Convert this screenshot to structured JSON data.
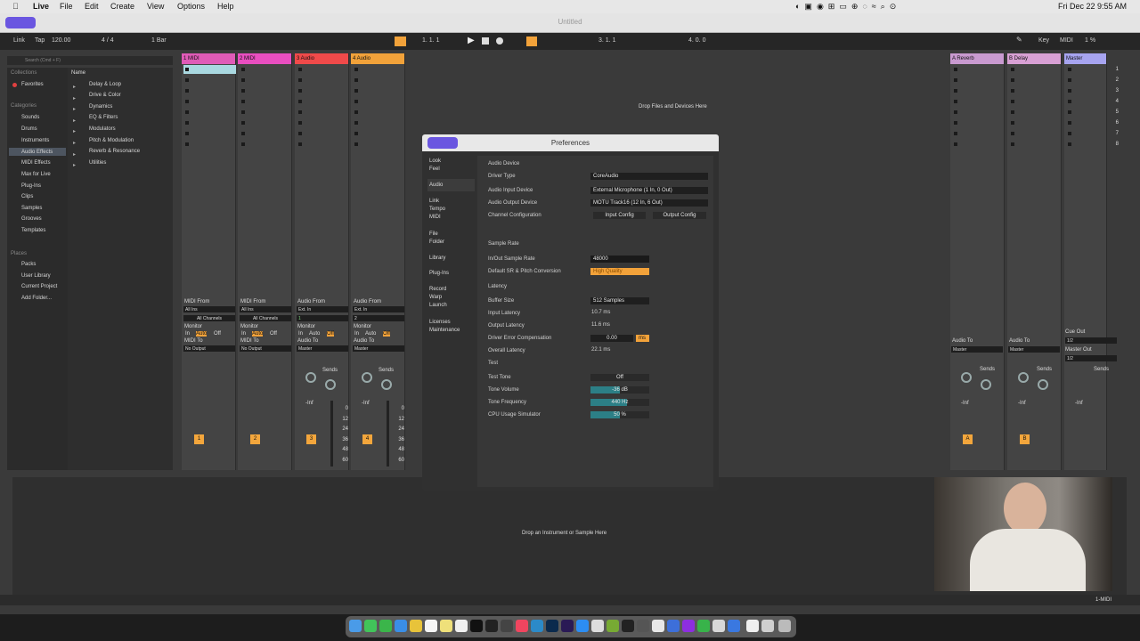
{
  "menubar": {
    "app": "Live",
    "items": [
      "File",
      "Edit",
      "Create",
      "View",
      "Options",
      "Help"
    ],
    "datetime": "Fri Dec 22  9:55 AM"
  },
  "window": {
    "title": "Untitled"
  },
  "control_bar": {
    "link": "Link",
    "tap": "Tap",
    "tempo": "120.00",
    "signature": "4 / 4",
    "quantize": "1 Bar",
    "position": "1.  1.  1",
    "loop_start": "3.  1.  1",
    "loop_length": "4.  0.  0",
    "key": "Key",
    "midi": "MIDI",
    "cpu": "1 %"
  },
  "browser": {
    "search_placeholder": "Search (Cmd + F)",
    "collections_header": "Collections",
    "collections": [
      "Favorites"
    ],
    "categories_header": "Categories",
    "categories": [
      "Sounds",
      "Drums",
      "Instruments",
      "Audio Effects",
      "MIDI Effects",
      "Max for Live",
      "Plug-Ins",
      "Clips",
      "Samples",
      "Grooves",
      "Templates"
    ],
    "places_header": "Places",
    "places": [
      "Packs",
      "User Library",
      "Current Project",
      "Add Folder..."
    ],
    "name_header": "Name",
    "folders": [
      "Delay & Loop",
      "Drive & Color",
      "Dynamics",
      "EQ & Filters",
      "Modulators",
      "Pitch & Modulation",
      "Reverb & Resonance",
      "Utilities"
    ]
  },
  "tracks": [
    {
      "name": "1 MIDI",
      "color": "#e05bb7",
      "io_label": "MIDI From",
      "io": "All Ins",
      "ch": "All Channels",
      "out_label": "MIDI To",
      "out": "No Output",
      "num": "1"
    },
    {
      "name": "2 MIDI",
      "color": "#e94ec0",
      "io_label": "MIDI From",
      "io": "All Ins",
      "ch": "All Channels",
      "out_label": "MIDI To",
      "out": "No Output",
      "num": "2"
    },
    {
      "name": "3 Audio",
      "color": "#f04a4a",
      "io_label": "Audio From",
      "io": "Ext. In",
      "ch": "1",
      "out_label": "Audio To",
      "out": "Master",
      "num": "3"
    },
    {
      "name": "4 Audio",
      "color": "#f2a23a",
      "io_label": "Audio From",
      "io": "Ext. In",
      "ch": "2",
      "out_label": "Audio To",
      "out": "Master",
      "num": "4"
    }
  ],
  "returns": [
    {
      "name": "A Reverb",
      "color": "#c99ad0",
      "out_label": "Audio To",
      "out": "Master",
      "num": "A"
    },
    {
      "name": "B Delay",
      "color": "#d8a0d4",
      "out_label": "Audio To",
      "out": "Master",
      "num": "B"
    },
    {
      "name": "Master",
      "color": "#a7a4f0",
      "out_label": "Master Out",
      "out": "1/2",
      "num": ""
    }
  ],
  "mixer_labels": {
    "monitor": "Monitor",
    "in": "In",
    "auto": "Auto",
    "off": "Off",
    "sends": "Sends",
    "inf": "-Inf",
    "db_scale": [
      "0",
      "12",
      "24",
      "36",
      "48",
      "60"
    ],
    "cue_out": "Cue Out",
    "cue_val": "1/2"
  },
  "session": {
    "drop_files": "Drop Files and Devices Here",
    "scene_numbers": [
      "1",
      "2",
      "3",
      "4",
      "5",
      "6",
      "7",
      "8"
    ]
  },
  "detail": {
    "drop_instrument": "Drop an Instrument or Sample Here",
    "status": "1-MIDI"
  },
  "preferences": {
    "title": "Preferences",
    "nav": [
      [
        "Look",
        "Feel"
      ],
      [
        "Audio"
      ],
      [
        "Link",
        "Tempo",
        "MIDI"
      ],
      [
        "File",
        "Folder"
      ],
      [
        "Library"
      ],
      [
        "Plug-Ins"
      ],
      [
        "Record",
        "Warp",
        "Launch"
      ],
      [
        "Licenses",
        "Maintenance"
      ]
    ],
    "audio_device_header": "Audio Device",
    "driver_type_label": "Driver Type",
    "driver_type": "CoreAudio",
    "input_device_label": "Audio Input Device",
    "input_device": "External Microphone (1 In, 0 Out)",
    "output_device_label": "Audio Output Device",
    "output_device": "MOTU Track16 (12 In, 6 Out)",
    "channel_config_label": "Channel Configuration",
    "input_config": "Input Config",
    "output_config": "Output Config",
    "sample_rate_header": "Sample Rate",
    "inout_sr_label": "In/Out Sample Rate",
    "inout_sr": "48000",
    "default_sr_label": "Default SR & Pitch Conversion",
    "default_sr": "High Quality",
    "latency_header": "Latency",
    "buffer_label": "Buffer Size",
    "buffer": "512 Samples",
    "input_latency_label": "Input Latency",
    "input_latency": "10.7 ms",
    "output_latency_label": "Output Latency",
    "output_latency": "11.6 ms",
    "driver_comp_label": "Driver Error Compensation",
    "driver_comp": "0.00",
    "driver_comp_unit": "ms",
    "overall_latency_label": "Overall Latency",
    "overall_latency": "22.1 ms",
    "test_header": "Test",
    "test_tone_label": "Test Tone",
    "test_tone": "Off",
    "tone_volume_label": "Tone Volume",
    "tone_volume": "-36 dB",
    "tone_freq_label": "Tone Frequency",
    "tone_freq": "440 Hz",
    "cpu_sim_label": "CPU Usage Simulator",
    "cpu_sim": "50 %"
  }
}
